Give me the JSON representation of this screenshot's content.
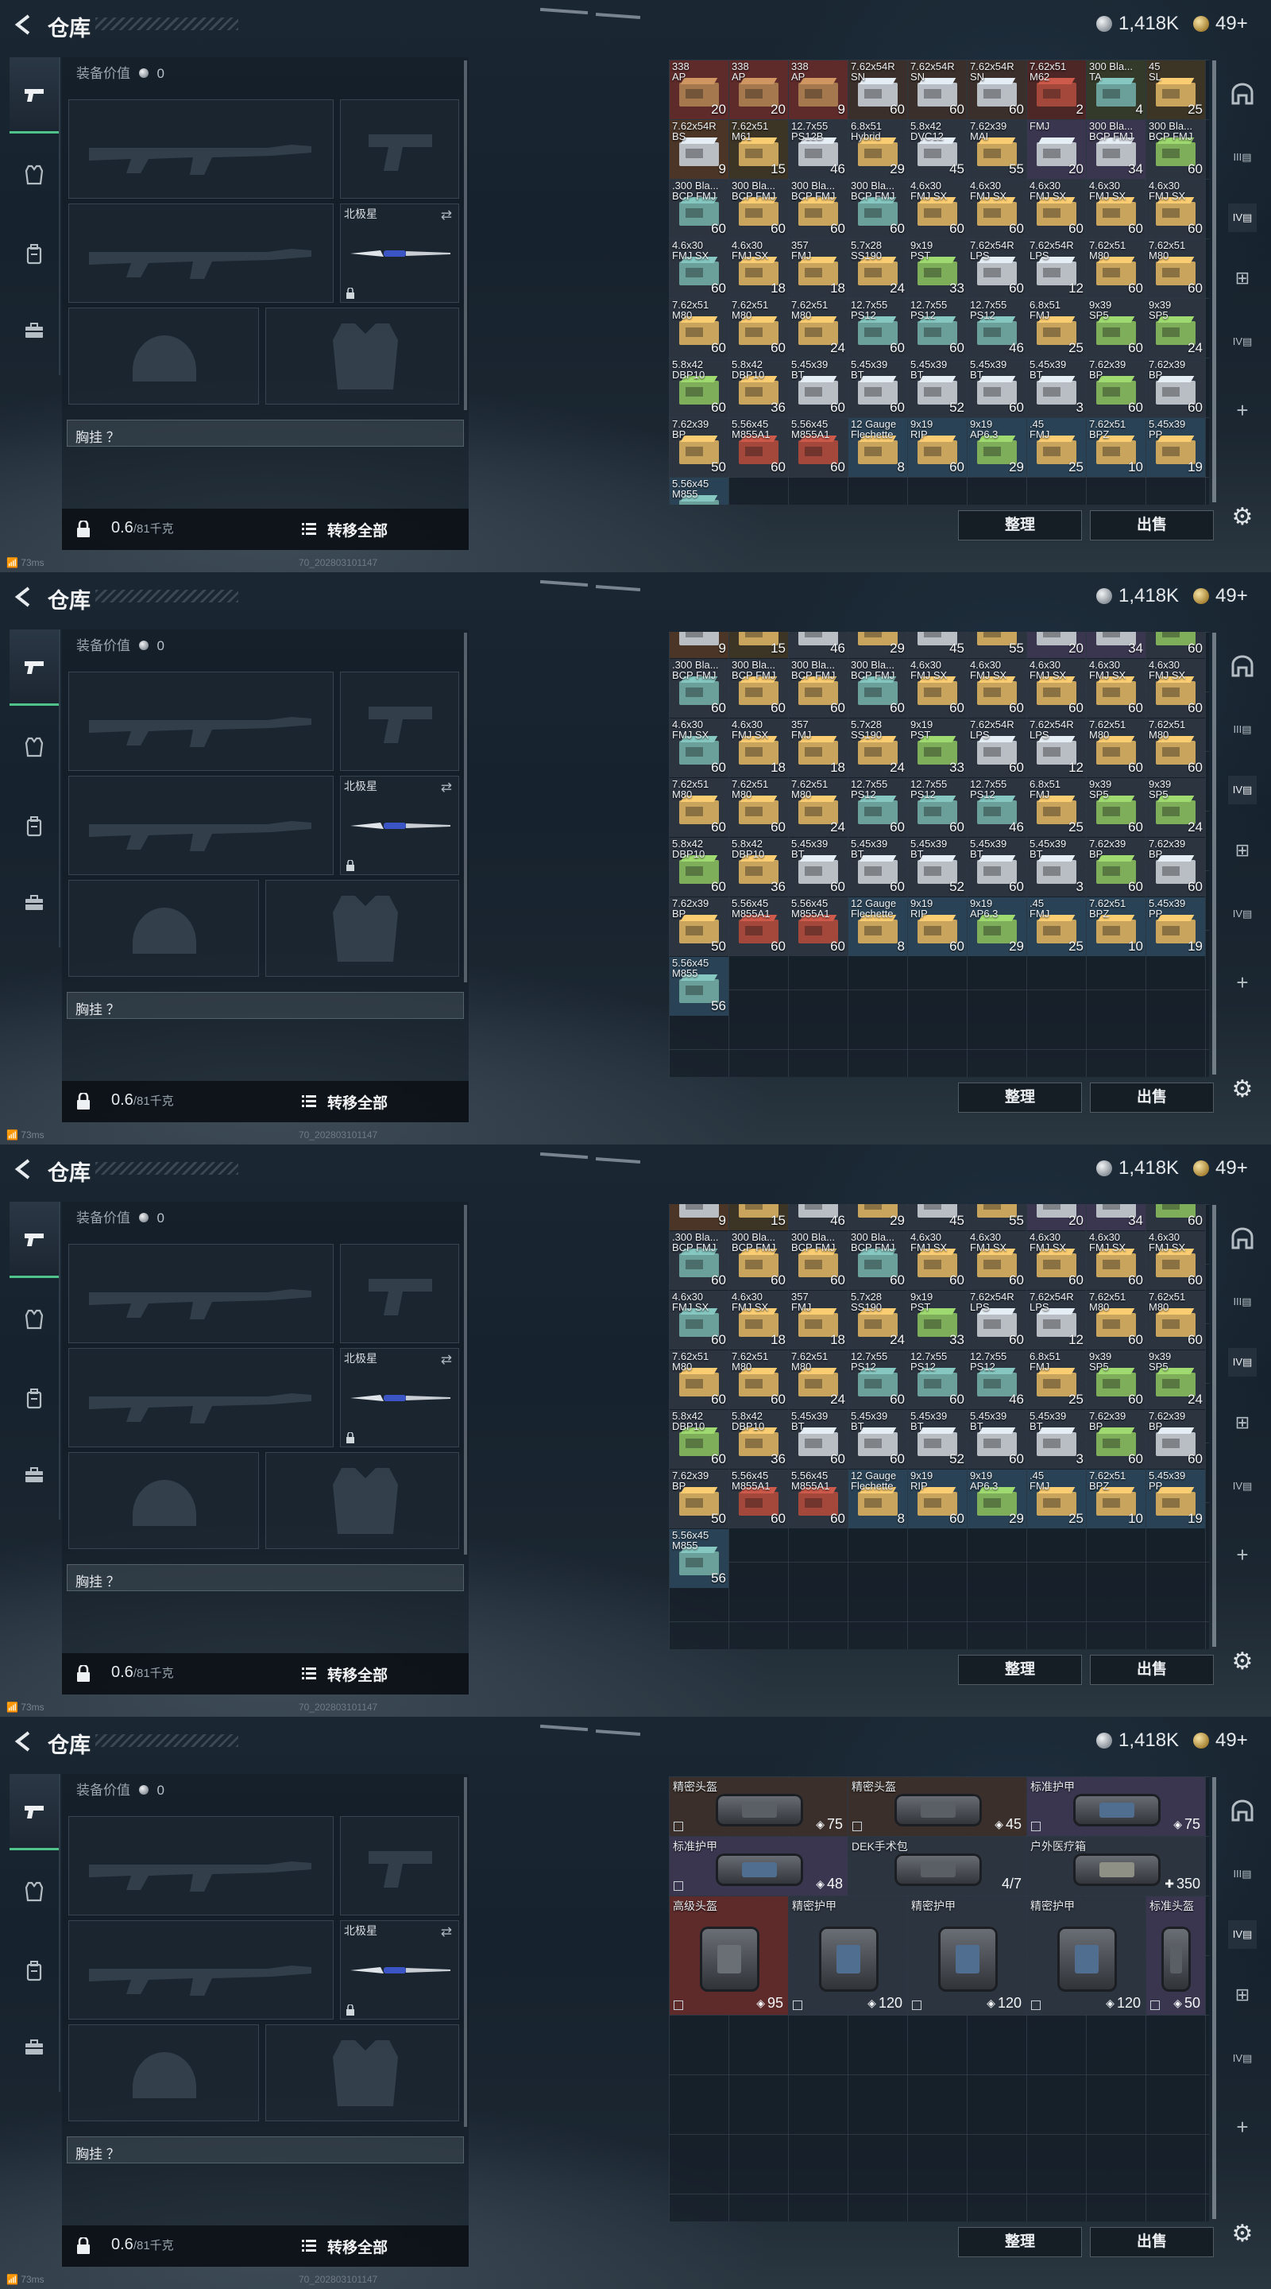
{
  "header": {
    "title": "仓库",
    "silver": "1,418K",
    "gold": "49+"
  },
  "equipment": {
    "value_label": "装备价值",
    "value": "0",
    "melee_label": "北极星",
    "chest_label": "胸挂 ？",
    "weight_value": "0.6",
    "weight_max": "/81千克",
    "transfer_all": "转移全部"
  },
  "buttons": {
    "sort": "整理",
    "sell": "出售"
  },
  "status": {
    "ping": "73ms",
    "build": "70_202803101147"
  },
  "colors": {
    "accent_green": "#4fc48a",
    "ammo_tan": "#c9a45c",
    "ammo_green": "#7fae5a",
    "ammo_teal": "#6b9f9a",
    "ammo_gray": "#b8bec4",
    "ammo_red": "#a4483c"
  },
  "ammo_rows": [
    [
      [
        "338",
        "AP",
        "20",
        "#a6784e",
        "#5e2a2a"
      ],
      [
        "338",
        "AP",
        "20",
        "#a6784e",
        "#5e2a2a"
      ],
      [
        "338",
        "AP",
        "9",
        "#a6784e",
        "#5e2a2a"
      ],
      [
        "7.62x54R",
        "SN",
        "60",
        "#b8bec4",
        "#3a2f2a"
      ],
      [
        "7.62x54R",
        "SN",
        "60",
        "#b8bec4",
        "#3a2f2a"
      ],
      [
        "7.62x54R",
        "SN",
        "60",
        "#b8bec4",
        "#3a2f2a"
      ],
      [
        "7.62x51",
        "M62",
        "2",
        "#a4483c",
        "#4d2626"
      ],
      [
        "300 Bla...",
        "TA",
        "4",
        "#6b9f9a",
        "#343a2a"
      ],
      [
        "45",
        "SL",
        "25",
        "#c9a45c",
        "#3c3526"
      ]
    ],
    [
      [
        "7.62x54R",
        "BS",
        "9",
        "#b8bec4",
        "#4a3526"
      ],
      [
        "7.62x51",
        "M61",
        "15",
        "#c9a45c",
        "#3c3526"
      ],
      [
        "12.7x55",
        "PS12B",
        "46",
        "#b8bec4",
        "#2c3440"
      ],
      [
        "6.8x51",
        "Hybrid",
        "29",
        "#c9a45c",
        "#2c3440"
      ],
      [
        "5.8x42",
        "DVC12",
        "45",
        "#b8bec4",
        "#2c3440"
      ],
      [
        "7.62x39",
        "MAI",
        "55",
        "#c9a45c",
        "#2c3440"
      ],
      [
        "FMJ",
        "",
        "20",
        "#b8bec4",
        "#3a3650"
      ],
      [
        "300 Bla...",
        "BCP FMJ",
        "34",
        "#b8bec4",
        "#3a3650"
      ],
      [
        "300 Bla...",
        "BCP FMJ",
        "60",
        "#7fae5a",
        "#2c3440"
      ]
    ],
    [
      [
        ".300 Bla...",
        "BCP FMJ",
        "60",
        "#6b9f9a",
        "#2c3440"
      ],
      [
        "300 Bla...",
        "BCP FMJ",
        "60",
        "#c9a45c",
        "#2c3440"
      ],
      [
        "300 Bla...",
        "BCP FMJ",
        "60",
        "#c9a45c",
        "#2c3440"
      ],
      [
        "300 Bla...",
        "BCP FMJ",
        "60",
        "#6b9f9a",
        "#2c3440"
      ],
      [
        "4.6x30",
        "FMJ SX",
        "60",
        "#c9a45c",
        "#2c3440"
      ],
      [
        "4.6x30",
        "FMJ SX",
        "60",
        "#c9a45c",
        "#2c3440"
      ],
      [
        "4.6x30",
        "FMJ SX",
        "60",
        "#c9a45c",
        "#2c3440"
      ],
      [
        "4.6x30",
        "FMJ SX",
        "60",
        "#c9a45c",
        "#2c3440"
      ],
      [
        "4.6x30",
        "FMJ SX",
        "60",
        "#c9a45c",
        "#2c3440"
      ]
    ],
    [
      [
        "4.6x30",
        "FMJ SX",
        "60",
        "#6b9f9a",
        "#2c3440"
      ],
      [
        "4.6x30",
        "FMJ SX",
        "18",
        "#c9a45c",
        "#2c3440"
      ],
      [
        "357",
        "FMJ",
        "18",
        "#c9a45c",
        "#2c3440"
      ],
      [
        "5.7x28",
        "SS190",
        "24",
        "#c9a45c",
        "#2c3440"
      ],
      [
        "9x19",
        "PST",
        "33",
        "#7fae5a",
        "#2c3440"
      ],
      [
        "7.62x54R",
        "LPS",
        "60",
        "#b8bec4",
        "#2c3440"
      ],
      [
        "7.62x54R",
        "LPS",
        "12",
        "#b8bec4",
        "#2c3440"
      ],
      [
        "7.62x51",
        "M80",
        "60",
        "#c9a45c",
        "#2c3440"
      ],
      [
        "7.62x51",
        "M80",
        "60",
        "#c9a45c",
        "#2c3440"
      ]
    ],
    [
      [
        "7.62x51",
        "M80",
        "60",
        "#c9a45c",
        "#2c3440"
      ],
      [
        "7.62x51",
        "M80",
        "60",
        "#c9a45c",
        "#2c3440"
      ],
      [
        "7.62x51",
        "M80",
        "24",
        "#c9a45c",
        "#2c3440"
      ],
      [
        "12.7x55",
        "PS12",
        "60",
        "#6b9f9a",
        "#2c3440"
      ],
      [
        "12.7x55",
        "PS12",
        "60",
        "#6b9f9a",
        "#2c3440"
      ],
      [
        "12.7x55",
        "PS12",
        "46",
        "#6b9f9a",
        "#2c3440"
      ],
      [
        "6.8x51",
        "FMJ",
        "25",
        "#c9a45c",
        "#2c3440"
      ],
      [
        "9x39",
        "SP5",
        "60",
        "#7fae5a",
        "#2c3440"
      ],
      [
        "9x39",
        "SP5",
        "24",
        "#7fae5a",
        "#2c3440"
      ]
    ],
    [
      [
        "5.8x42",
        "DBP10",
        "60",
        "#7fae5a",
        "#2c3440"
      ],
      [
        "5.8x42",
        "DBP10",
        "36",
        "#c9a45c",
        "#2c3440"
      ],
      [
        "5.45x39",
        "BT",
        "60",
        "#b8bec4",
        "#2c3440"
      ],
      [
        "5.45x39",
        "BT",
        "60",
        "#b8bec4",
        "#2c3440"
      ],
      [
        "5.45x39",
        "BT",
        "52",
        "#b8bec4",
        "#2c3440"
      ],
      [
        "5.45x39",
        "BT",
        "60",
        "#b8bec4",
        "#2c3440"
      ],
      [
        "5.45x39",
        "BT",
        "3",
        "#b8bec4",
        "#2c3440"
      ],
      [
        "7.62x39",
        "BP",
        "60",
        "#7fae5a",
        "#2c3440"
      ],
      [
        "7.62x39",
        "BP",
        "60",
        "#b8bec4",
        "#2c3440"
      ]
    ],
    [
      [
        "7.62x39",
        "BP",
        "50",
        "#c9a45c",
        "#2c3440"
      ],
      [
        "5.56x45",
        "M855A1",
        "60",
        "#a4483c",
        "#2c3440"
      ],
      [
        "5.56x45",
        "M855A1",
        "60",
        "#a4483c",
        "#2c3440"
      ],
      [
        "12 Gauge",
        "Flechette",
        "8",
        "#c9a45c",
        "#2a4255"
      ],
      [
        "9x19",
        "RIP",
        "60",
        "#c9a45c",
        "#2a4255"
      ],
      [
        "9x19",
        "AP6.3",
        "29",
        "#7fae5a",
        "#2a4255"
      ],
      [
        ".45",
        "FMJ",
        "25",
        "#c9a45c",
        "#2a4255"
      ],
      [
        "7.62x51",
        "BPZ",
        "10",
        "#c9a45c",
        "#2a4255"
      ],
      [
        "5.45x39",
        "PP",
        "19",
        "#c9a45c",
        "#2a4255"
      ]
    ],
    [
      [
        "5.56x45",
        "M855",
        "56",
        "#6b9f9a",
        "#2a4255"
      ]
    ]
  ],
  "gear_items": [
    {
      "name": "精密头盔",
      "value": "75",
      "icon": "shield-icon",
      "color": "#3a2f2a",
      "box": "#5a5f66"
    },
    {
      "name": "精密头盔",
      "value": "45",
      "icon": "shield-icon",
      "color": "#3a2f2a",
      "box": "#5a5f66"
    },
    {
      "name": "标准护甲",
      "value": "75",
      "icon": "shield-icon",
      "color": "#3a3650",
      "box": "#4f6e90"
    },
    {
      "name": "标准护甲",
      "value": "48",
      "icon": "shield-icon",
      "color": "#3a3650",
      "box": "#4f6e90"
    },
    {
      "name": "DEK手术包",
      "value": "4/7",
      "icon": "",
      "color": "#2c3440",
      "box": "#5a5f66"
    },
    {
      "name": "户外医疗箱",
      "value": "350",
      "icon": "plus-icon",
      "color": "#2c3440",
      "box": "#8e9085"
    },
    {
      "name": "高级头盔",
      "value": "95",
      "icon": "shield-icon",
      "color": "#5e2a2a",
      "box": "#6a6e75"
    },
    {
      "name": "精密护甲",
      "value": "120",
      "icon": "shield-icon",
      "color": "#2c3440",
      "box": "#4f6e90"
    },
    {
      "name": "精密护甲",
      "value": "120",
      "icon": "shield-icon",
      "color": "#2c3440",
      "box": "#4f6e90"
    },
    {
      "name": "精密护甲",
      "value": "120",
      "icon": "shield-icon",
      "color": "#2c3440",
      "box": "#4f6e90"
    },
    {
      "name": "标准头盔",
      "value": "50",
      "icon": "shield-icon",
      "color": "#3a3650",
      "box": "#5a5f66"
    }
  ],
  "frames": [
    {
      "label": "ammo-top",
      "first_row": 0,
      "scroll": 0
    },
    {
      "label": "ammo-scrolled",
      "first_row": 1,
      "scroll": 1
    },
    {
      "label": "ammo-scrolled-more",
      "first_row": 1,
      "scroll": 2
    },
    {
      "label": "gear",
      "first_row": -1,
      "scroll": 3
    }
  ]
}
